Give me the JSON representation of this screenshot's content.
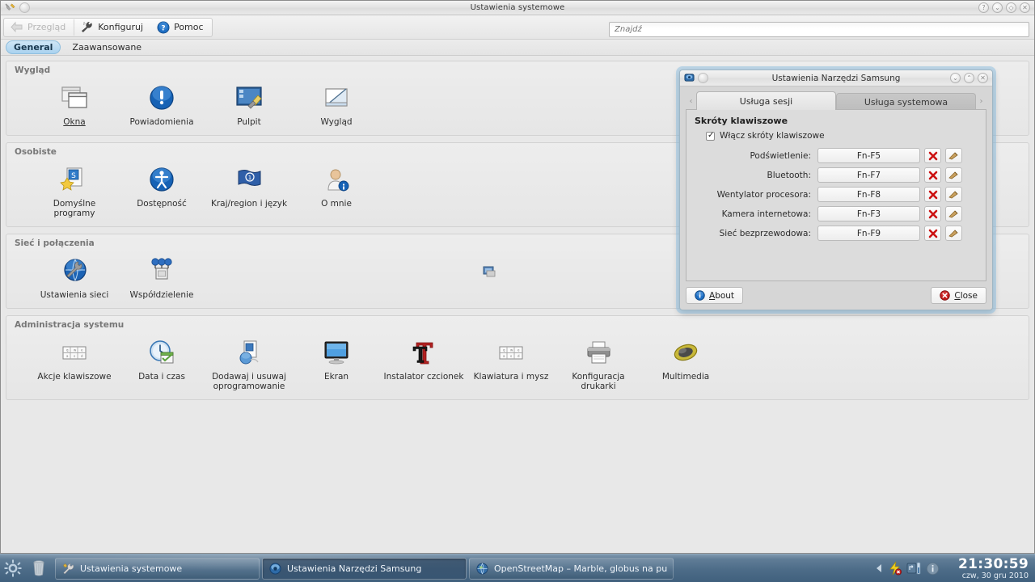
{
  "window": {
    "title": "Ustawienia systemowe",
    "titlebar_buttons": [
      "help-button",
      "minimize-button",
      "maximize-button",
      "close-button"
    ],
    "titlebar_button_glyphs": [
      "?",
      "⌄",
      "◇",
      "✕"
    ]
  },
  "toolbar": {
    "back_label": "Przegląd",
    "configure_label": "Konfiguruj",
    "help_label": "Pomoc"
  },
  "search": {
    "placeholder": "Znajdź",
    "value": ""
  },
  "tabs": [
    {
      "label": "General",
      "active": true
    },
    {
      "label": "Zaawansowane",
      "active": false
    }
  ],
  "groups": [
    {
      "title": "Wygląd",
      "items": [
        {
          "label": "Okna",
          "icon": "windows-icon",
          "hovered": true
        },
        {
          "label": "Powiadomienia",
          "icon": "notifications-icon",
          "hovered": false
        },
        {
          "label": "Pulpit",
          "icon": "desktop-icon",
          "hovered": false
        },
        {
          "label": "Wygląd",
          "icon": "appearance-icon",
          "hovered": false
        }
      ]
    },
    {
      "title": "Osobiste",
      "items": [
        {
          "label": "Domyślne programy",
          "icon": "default-apps-icon",
          "hovered": false
        },
        {
          "label": "Dostępność",
          "icon": "accessibility-icon",
          "hovered": false
        },
        {
          "label": "Kraj/region i język",
          "icon": "locale-icon",
          "hovered": false
        },
        {
          "label": "O mnie",
          "icon": "about-me-icon",
          "hovered": false
        }
      ]
    },
    {
      "title": "Sieć i połączenia",
      "items": [
        {
          "label": "Ustawienia sieci",
          "icon": "network-settings-icon",
          "hovered": false
        },
        {
          "label": "Współdzielenie",
          "icon": "sharing-icon",
          "hovered": false
        }
      ]
    },
    {
      "title": "Administracja systemu",
      "items": [
        {
          "label": "Akcje klawiszowe",
          "icon": "key-actions-icon",
          "hovered": false
        },
        {
          "label": "Data i czas",
          "icon": "date-time-icon",
          "hovered": false
        },
        {
          "label": "Dodawaj i usuwaj oprogramowanie",
          "icon": "software-icon",
          "hovered": false
        },
        {
          "label": "Ekran",
          "icon": "display-icon",
          "hovered": false
        },
        {
          "label": "Instalator czcionek",
          "icon": "font-installer-icon",
          "hovered": false
        },
        {
          "label": "Klawiatura i mysz",
          "icon": "keyboard-mouse-icon",
          "hovered": false
        },
        {
          "label": "Konfiguracja drukarki",
          "icon": "printer-icon",
          "hovered": false
        },
        {
          "label": "Multimedia",
          "icon": "multimedia-icon",
          "hovered": false
        }
      ]
    }
  ],
  "dialog": {
    "title": "Ustawienia Narzędzi Samsung",
    "titlebar_button_glyphs": [
      "⌄",
      "⌃",
      "✕"
    ],
    "tab_prev_glyph": "‹",
    "tab_next_glyph": "›",
    "tabs": [
      {
        "label": "Usługa sesji",
        "active": true
      },
      {
        "label": "Usługa systemowa",
        "active": false
      }
    ],
    "panel_title": "Skróty klawiszowe",
    "enable_checkbox_label": "Włącz skróty klawiszowe",
    "enable_checkbox_checked": true,
    "shortcuts": [
      {
        "name": "Podświetlenie:",
        "key": "Fn-F5"
      },
      {
        "name": "Bluetooth:",
        "key": "Fn-F7"
      },
      {
        "name": "Wentylator procesora:",
        "key": "Fn-F8"
      },
      {
        "name": "Kamera internetowa:",
        "key": "Fn-F3"
      },
      {
        "name": "Sieć bezprzewodowa:",
        "key": "Fn-F9"
      }
    ],
    "clear_button_name": "clear-shortcut-button",
    "record_button_name": "record-shortcut-button",
    "about_label": "About",
    "about_accel": "A",
    "close_label": "Close",
    "close_accel": "C"
  },
  "taskbar": {
    "tasks": [
      {
        "label": "Ustawienia systemowe",
        "icon": "system-settings-icon",
        "active": false
      },
      {
        "label": "Ustawienia Narzędzi Samsung",
        "icon": "samsung-tools-icon",
        "active": true
      },
      {
        "label": "OpenStreetMap – Marble, globus na pu",
        "icon": "marble-icon",
        "active": false
      }
    ],
    "tray_icons": [
      "tray-expand-arrow-icon",
      "battery-icon",
      "network-icon",
      "info-icon"
    ],
    "clock_time": "21:30:59",
    "clock_date": "czw, 30 gru 2010"
  },
  "colors": {
    "accent": "#a9d2ef",
    "taskbar": "#4d6c88",
    "dialog_glow": "#96c3e1",
    "icon_blue": "#1f6fc4",
    "danger": "#cc1111"
  }
}
